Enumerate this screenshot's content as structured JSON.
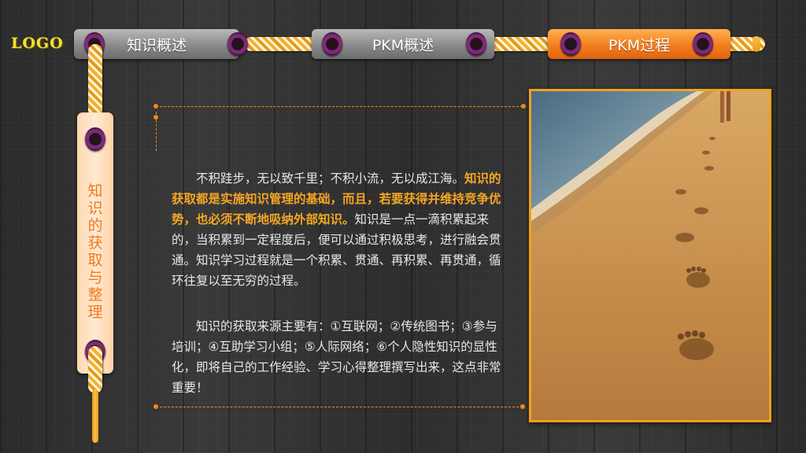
{
  "logo": {
    "text": "LOGO"
  },
  "nav": {
    "tabs": [
      {
        "label": "知识概述",
        "active": false
      },
      {
        "label": "PKM概述",
        "active": false
      },
      {
        "label": "PKM过程",
        "active": true
      }
    ]
  },
  "section": {
    "title": "知识的获取与整理"
  },
  "content": {
    "p1_lead": "不积跬步，无以致千里；不积小流，无以成江海。",
    "p1_highlight": "知识的获取都是实施知识管理的基础，而且，若要获得并维持竞争优势，也必须不断地吸纳外部知识。",
    "p1_rest": "知识是一点一滴积累起来的，当积累到一定程度后，便可以通过积极思考，进行融会贯通。知识学习过程就是一个积累、贯通、再积累、再贯通，循环往复以至无穷的过程。",
    "p2": "知识的获取来源主要有：①互联网；②传统图书；③参与培训；④互助学习小组；⑤人际网络；⑥个人隐性知识的显性化，即将自己的工作经验、学习心得整理撰写出来，这点非常重要！"
  },
  "colors": {
    "accent_orange": "#f07a1c",
    "highlight_text": "#f5a623",
    "logo_yellow": "#f5e12a",
    "eyelet_purple": "#7d2a78"
  },
  "image": {
    "subject": "footprints-on-beach-photo"
  }
}
